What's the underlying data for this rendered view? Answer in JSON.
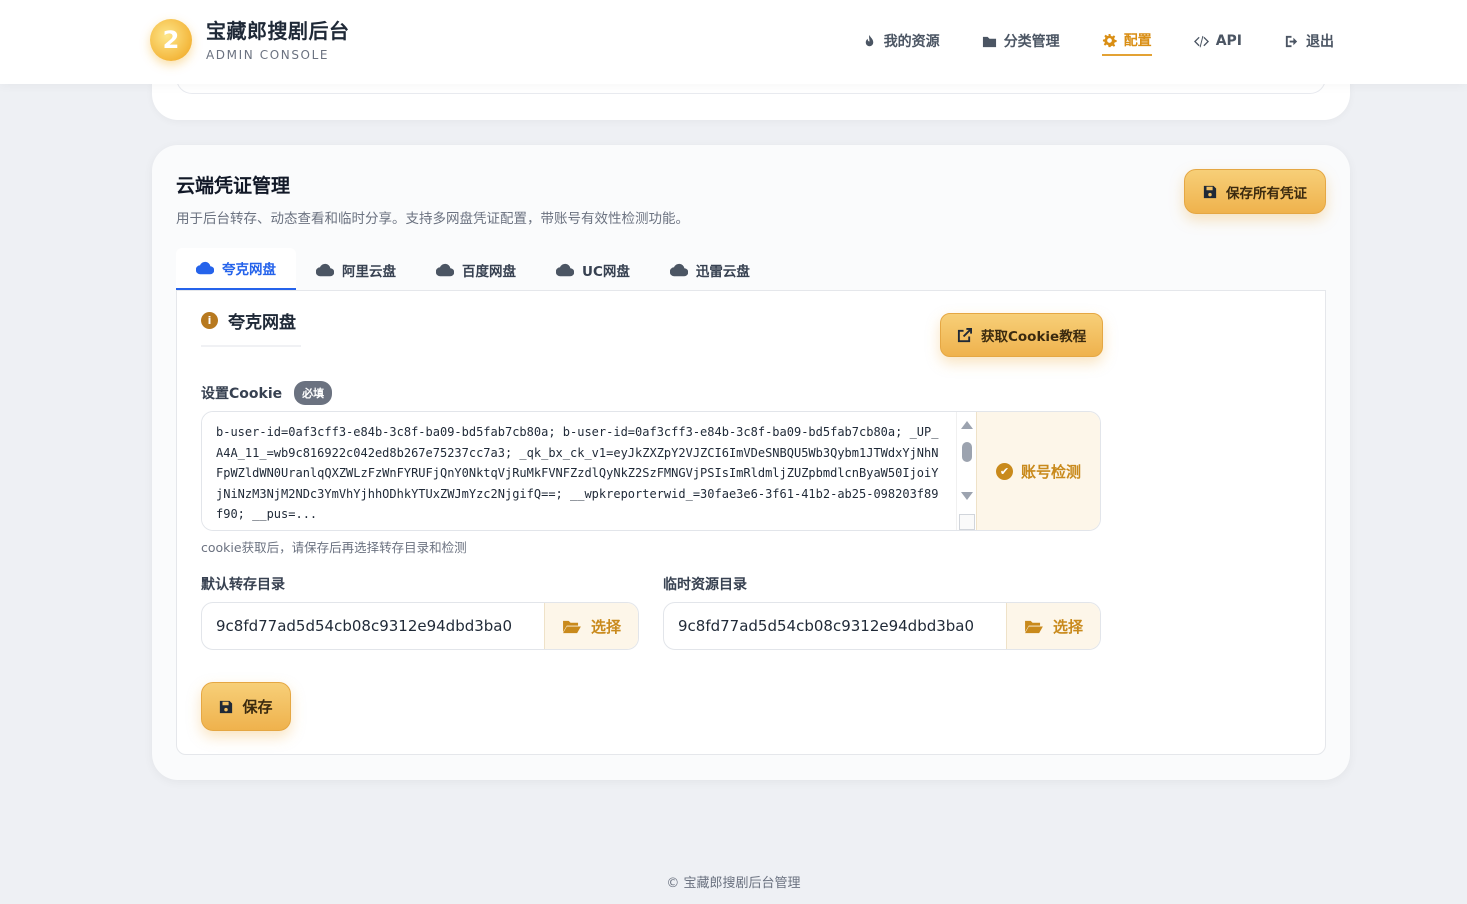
{
  "header": {
    "title": "宝藏郎搜剧后台",
    "subtitle": "ADMIN CONSOLE",
    "logo_glyph": "2",
    "nav": [
      {
        "label": "我的资源",
        "icon": "fire-icon",
        "active": false
      },
      {
        "label": "分类管理",
        "icon": "folder-icon",
        "active": false
      },
      {
        "label": "配置",
        "icon": "gear-icon",
        "active": true
      },
      {
        "label": "API",
        "icon": "code-icon",
        "active": false
      },
      {
        "label": "退出",
        "icon": "logout-icon",
        "active": false
      }
    ]
  },
  "card": {
    "title": "云端凭证管理",
    "description": "用于后台转存、动态查看和临时分享。支持多网盘凭证配置，带账号有效性检测功能。",
    "save_all_label": "保存所有凭证",
    "tabs": [
      {
        "label": "夸克网盘",
        "active": true
      },
      {
        "label": "阿里云盘",
        "active": false
      },
      {
        "label": "百度网盘",
        "active": false
      },
      {
        "label": "UC网盘",
        "active": false
      },
      {
        "label": "迅雷云盘",
        "active": false
      }
    ]
  },
  "panel": {
    "info_glyph": "i",
    "title": "夸克网盘",
    "tutorial_label": "获取Cookie教程",
    "cookie_label": "设置Cookie",
    "required_badge": "必填",
    "cookie_value": "b-user-id=0af3cff3-e84b-3c8f-ba09-bd5fab7cb80a; b-user-id=0af3cff3-e84b-3c8f-ba09-bd5fab7cb80a; _UP_A4A_11_=wb9c816922c042ed8b267e75237cc7a3; _qk_bx_ck_v1=eyJkZXZpY2VJZCI6ImVDeSNBQU5Wb3Qybm1JTWdxYjNhNFpWZldWN0UranlqQXZWLzFzWnFYRUFjQnY0NktqVjRuMkFVNFZzdlQyNkZ2SzFMNGVjPSIsImRldmljZUZpbmdlcnByaW50IjoiYjNiNzM3NjM2NDc3YmVhYjhhODhkYTUxZWJmYzc2NjgifQ==; __wpkreporterwid_=30fae3e6-3f61-41b2-ab25-098203f89f90; __pus=...",
    "check_label": "账号检测",
    "check_glyph": "✔",
    "cookie_hint": "cookie获取后，请保存后再选择转存目录和检测",
    "default_dir_label": "默认转存目录",
    "default_dir_value": "9c8fd77ad5d54cb08c9312e94dbd3ba0",
    "temp_dir_label": "临时资源目录",
    "temp_dir_value": "9c8fd77ad5d54cb08c9312e94dbd3ba0",
    "choose_label": "选择",
    "save_label": "保存"
  },
  "footer": {
    "text": "© 宝藏郎搜剧后台管理"
  },
  "colors": {
    "accent": "#efb24d",
    "active_tab": "#2563eb",
    "background": "#eef0f4"
  }
}
